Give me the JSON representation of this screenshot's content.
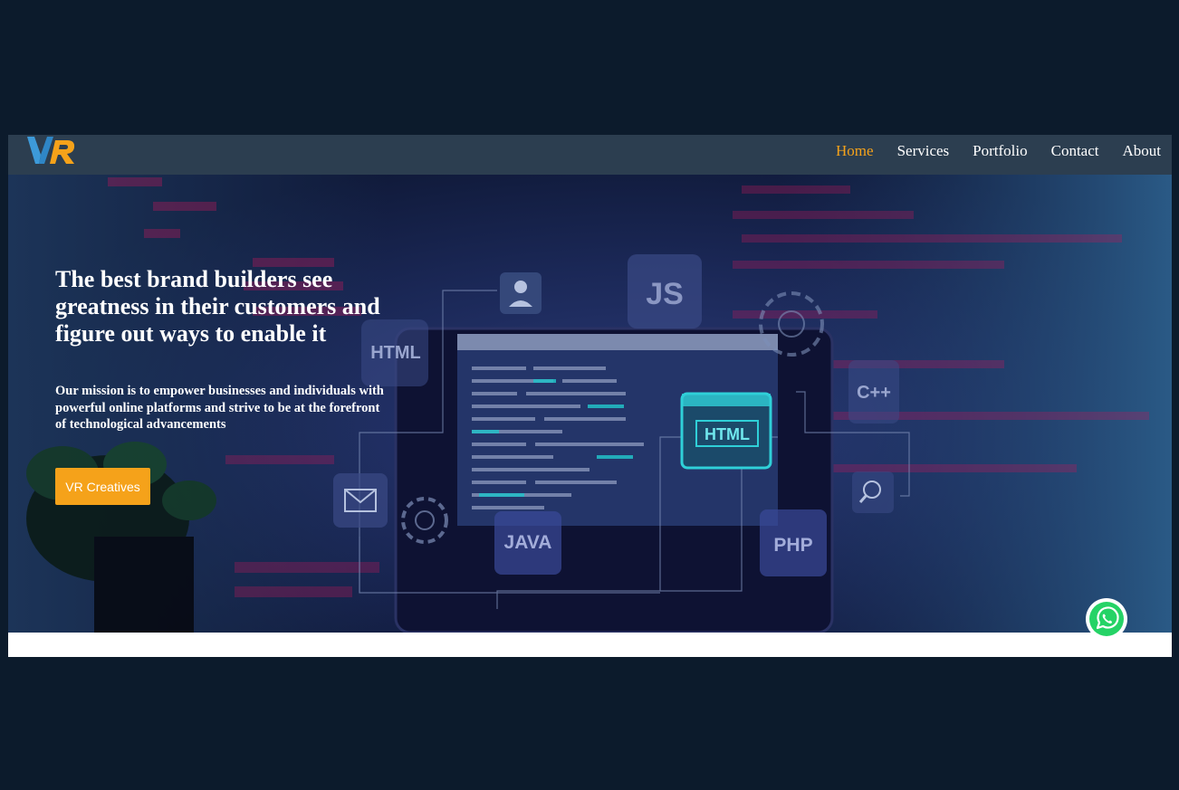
{
  "brand": {
    "logo_text": "VR",
    "colors": {
      "v": "#3d9ad9",
      "r": "#f5a21a"
    }
  },
  "nav": {
    "items": [
      {
        "label": "Home",
        "active": true
      },
      {
        "label": "Services",
        "active": false
      },
      {
        "label": "Portfolio",
        "active": false
      },
      {
        "label": "Contact",
        "active": false
      },
      {
        "label": "About",
        "active": false
      }
    ]
  },
  "hero": {
    "title": "The best brand builders see greatness in their customers and figure out ways to enable it",
    "mission": "Our mission is to empower businesses and individuals with powerful online platforms and strive to be at the forefront of technological advancements",
    "cta_label": "VR Creatives",
    "background_labels": {
      "js": "JS",
      "html_badge": "HTML",
      "html_screen": "HTML",
      "cpp": "C++",
      "java": "JAVA",
      "php": "PHP"
    }
  },
  "colors": {
    "page_bg": "#0c1b2c",
    "navbar_bg": "#2c3e50",
    "accent": "#f5a21a",
    "whatsapp": "#25d366"
  },
  "icons": {
    "whatsapp": "whatsapp-icon"
  }
}
